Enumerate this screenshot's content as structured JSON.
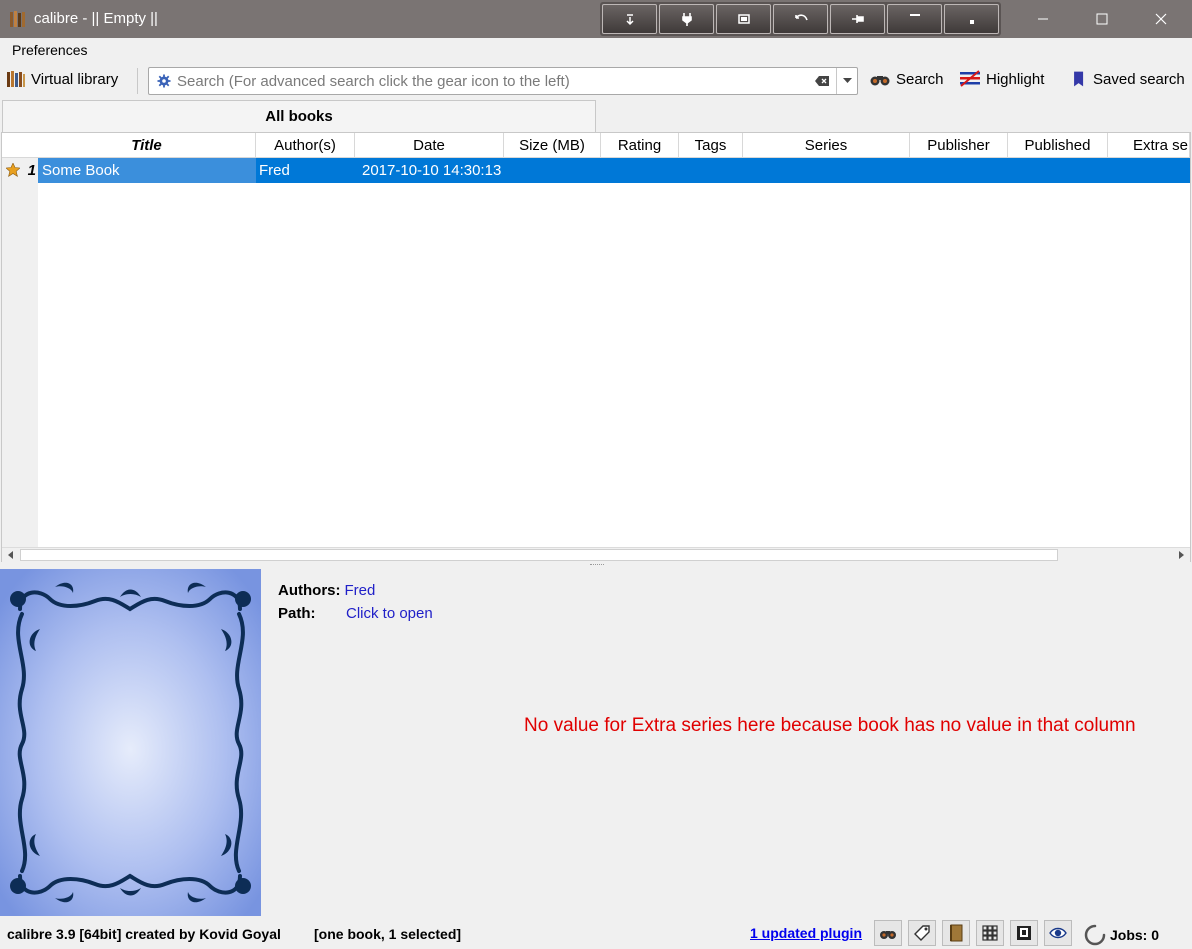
{
  "window": {
    "title": "calibre - || Empty ||",
    "icon": "calibre-library-icon",
    "controls": [
      "minimize-icon",
      "maximize-icon",
      "close-icon"
    ]
  },
  "menu": {
    "preferences": "Preferences"
  },
  "toolbar": {
    "virtual_library": "Virtual library",
    "search_placeholder": "Search (For advanced search click the gear icon to the left)",
    "search_button": "Search",
    "highlight_button": "Highlight",
    "saved_search_button": "Saved search"
  },
  "tabs": {
    "active": "All books"
  },
  "table": {
    "columns": [
      "Title",
      "Author(s)",
      "Date",
      "Size (MB)",
      "Rating",
      "Tags",
      "Series",
      "Publisher",
      "Published",
      "Extra series"
    ],
    "sorted_column": "Title",
    "rows": [
      {
        "num": "1",
        "title": "Some Book",
        "author": "Fred",
        "date": "2017-10-10 14:30:13",
        "selected": true
      }
    ]
  },
  "details": {
    "authors_label": "Authors:",
    "authors_value": "Fred",
    "path_label": "Path:",
    "path_value": "Click to open",
    "annotation": "No value for Extra series here because book has no value in that column"
  },
  "statusbar": {
    "version": "calibre 3.9 [64bit] created by Kovid Goyal",
    "selection": "[one book, 1 selected]",
    "plugin_link": "1 updated plugin",
    "jobs": "Jobs: 0"
  },
  "colors": {
    "titlebar": "#7a7473",
    "selection": "#0078d7",
    "annotation": "#e00000",
    "link": "#2020c8"
  }
}
